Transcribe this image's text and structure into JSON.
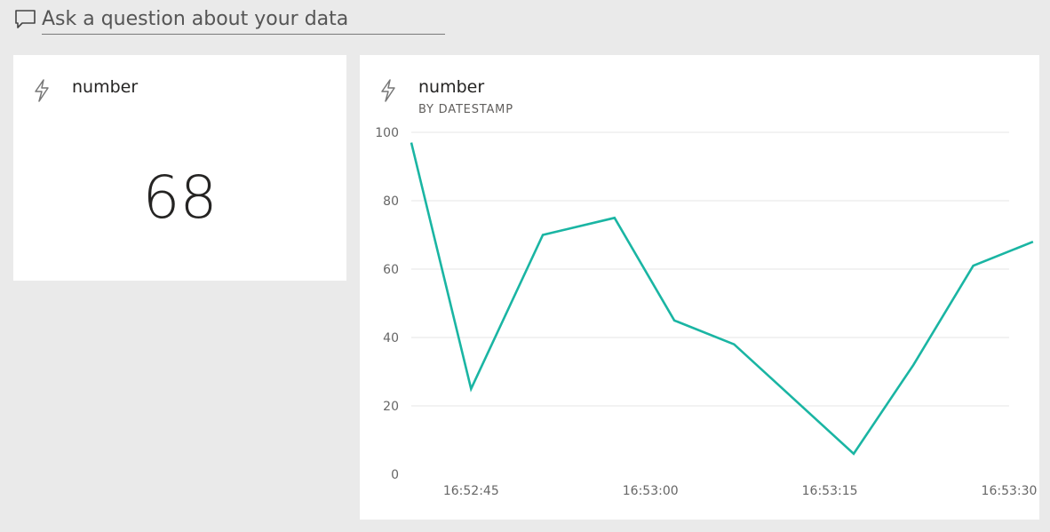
{
  "qa": {
    "placeholder": "Ask a question about your data",
    "icon": "speech-bubble-icon"
  },
  "tiles": [
    {
      "title": "number",
      "icon": "lightning-bolt-icon",
      "value": "68"
    },
    {
      "title": "number",
      "subtitle": "BY DATESTAMP",
      "icon": "lightning-bolt-icon"
    }
  ],
  "colors": {
    "background": "#eaeaea",
    "tile": "#ffffff",
    "line": "#1ab5a3",
    "grid": "#e6e6e6"
  },
  "chart_data": {
    "type": "line",
    "title": "number",
    "subtitle": "BY DATESTAMP",
    "x_tick_labels": [
      "16:52:45",
      "16:53:00",
      "16:53:15",
      "16:53:30"
    ],
    "y_ticks": [
      0,
      20,
      40,
      60,
      80,
      100
    ],
    "ylim": [
      0,
      100
    ],
    "xlim_seconds": [
      0,
      50
    ],
    "x_ticks_seconds": [
      5,
      20,
      35,
      50
    ],
    "x": [
      "16:52:40",
      "16:52:45",
      "16:52:51",
      "16:52:57",
      "16:53:02",
      "16:53:07",
      "16:53:17",
      "16:53:22",
      "16:53:27",
      "16:53:32"
    ],
    "series": [
      {
        "values": [
          97,
          25,
          70,
          75,
          45,
          38,
          6,
          32,
          61,
          68
        ]
      }
    ],
    "grid": true,
    "legend": false
  }
}
